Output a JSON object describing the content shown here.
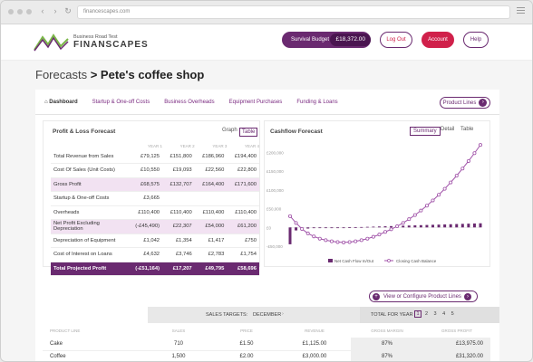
{
  "browser": {
    "url": "financescapes.com"
  },
  "header": {
    "logo_subtitle": "Business Road Test",
    "logo_title": "FINANSCAPES",
    "survival_label": "Survival Budget",
    "survival_value": "£18,372.00",
    "logout": "Log Out",
    "account": "Account",
    "help": "Help"
  },
  "page": {
    "section": "Forecasts",
    "chevron": ">",
    "name": "Pete's coffee shop"
  },
  "tabs": [
    "Dashboard",
    "Startup & One-off Costs",
    "Business Overheads",
    "Equipment Purchases",
    "Funding & Loans"
  ],
  "product_lines_btn": "Product Lines",
  "pl": {
    "title": "Profit & Loss Forecast",
    "toggles": [
      "Graph",
      "Table"
    ],
    "years": [
      "YEAR 1",
      "YEAR 2",
      "YEAR 3",
      "YEAR 4"
    ],
    "rows": [
      {
        "label": "Total Revenue from Sales",
        "v": [
          "£79,125",
          "£151,800",
          "£186,960",
          "£194,400"
        ]
      },
      {
        "label": "Cost Of Sales (Unit Costs)",
        "v": [
          "£10,550",
          "£19,093",
          "£22,560",
          "£22,800"
        ]
      },
      {
        "label": "Gross Profit",
        "v": [
          "£68,575",
          "£132,707",
          "£164,400",
          "£171,600"
        ]
      },
      {
        "label": "Startup & One-off Costs",
        "v": [
          "£3,665",
          "",
          "",
          ""
        ]
      },
      {
        "label": "Overheads",
        "v": [
          "£110,400",
          "£110,400",
          "£110,400",
          "£110,400"
        ]
      },
      {
        "label": "Net Profit Excluding Depreciation",
        "v": [
          "(-£45,490)",
          "£22,307",
          "£54,000",
          "£61,200"
        ]
      },
      {
        "label": "Depreciation of Equipment",
        "v": [
          "£1,042",
          "£1,354",
          "£1,417",
          "£750"
        ]
      },
      {
        "label": "Cost of Interest on Loans",
        "v": [
          "£4,632",
          "£3,746",
          "£2,783",
          "£1,754"
        ]
      },
      {
        "label": "Total Projected Profit",
        "v": [
          "(-£51,164)",
          "£17,207",
          "£49,795",
          "£58,696"
        ]
      }
    ]
  },
  "cf": {
    "title": "Cashflow Forecast",
    "toggles": [
      "Summary",
      "Detail",
      "Table"
    ],
    "y_ticks": [
      "£200,000",
      "£150,000",
      "£100,000",
      "£50,000",
      "£0",
      "-£50,000"
    ],
    "legend": [
      "Net Cash Flow In/Out",
      "Closing Cash Balance"
    ],
    "colors": {
      "accent": "#6a2a70",
      "line": "#a052a8"
    }
  },
  "chart_data": {
    "type": "line",
    "title": "Cashflow Forecast",
    "ylim": [
      -50000,
      230000
    ],
    "series": [
      {
        "name": "Closing Cash Balance",
        "values": [
          30000,
          12000,
          -4000,
          -16000,
          -24000,
          -30000,
          -34000,
          -37000,
          -39000,
          -40000,
          -39000,
          -37000,
          -34000,
          -30000,
          -25000,
          -19000,
          -12000,
          -5000,
          3000,
          12000,
          22000,
          33000,
          45000,
          58000,
          72000,
          87000,
          103000,
          120000,
          138000,
          157000,
          177000,
          198000,
          220000
        ]
      },
      {
        "name": "Net Cash Flow In/Out",
        "values": [
          -45000,
          -8000,
          -4000,
          -3000,
          -2000,
          -1500,
          -1000,
          -800,
          -500,
          -200,
          200,
          600,
          1000,
          1500,
          2000,
          2500,
          3000,
          3500,
          4000,
          4500,
          5000,
          5500,
          6000,
          6500,
          7000,
          7500,
          8000,
          8500,
          9000,
          9500,
          10000,
          10500,
          11000
        ]
      }
    ]
  },
  "view_configure": "View or Configure Product Lines",
  "sales": {
    "targets_label": "SALES TARGETS:",
    "month": "DECEMBER",
    "total_label": "TOTAL FOR YEAR",
    "years": [
      "1",
      "2",
      "3",
      "4",
      "5"
    ],
    "columns": [
      "PRODUCT LINE",
      "SALES",
      "PRICE",
      "REVENUE",
      "GROSS MARGIN",
      "GROSS PROFIT"
    ],
    "rows": [
      {
        "name": "Cake",
        "sales": "710",
        "price": "£1.50",
        "revenue": "£1,125.00",
        "margin": "87%",
        "profit": "£13,975.00"
      },
      {
        "name": "Coffee",
        "sales": "1,500",
        "price": "£2.00",
        "revenue": "£3,000.00",
        "margin": "87%",
        "profit": "£31,320.00"
      }
    ]
  }
}
